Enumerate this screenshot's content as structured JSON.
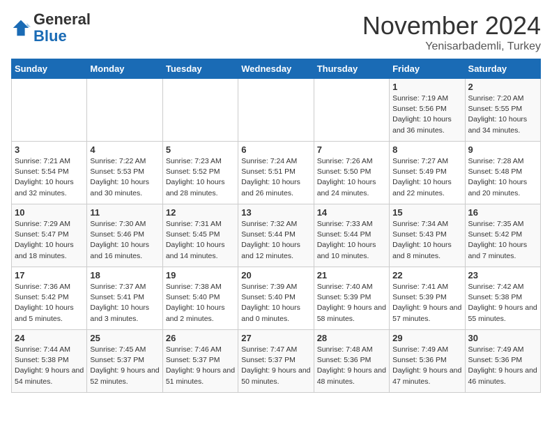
{
  "header": {
    "logo_general": "General",
    "logo_blue": "Blue",
    "month_title": "November 2024",
    "subtitle": "Yenisarbademli, Turkey"
  },
  "days_of_week": [
    "Sunday",
    "Monday",
    "Tuesday",
    "Wednesday",
    "Thursday",
    "Friday",
    "Saturday"
  ],
  "weeks": [
    [
      {
        "day": "",
        "info": ""
      },
      {
        "day": "",
        "info": ""
      },
      {
        "day": "",
        "info": ""
      },
      {
        "day": "",
        "info": ""
      },
      {
        "day": "",
        "info": ""
      },
      {
        "day": "1",
        "info": "Sunrise: 7:19 AM\nSunset: 5:56 PM\nDaylight: 10 hours and 36 minutes."
      },
      {
        "day": "2",
        "info": "Sunrise: 7:20 AM\nSunset: 5:55 PM\nDaylight: 10 hours and 34 minutes."
      }
    ],
    [
      {
        "day": "3",
        "info": "Sunrise: 7:21 AM\nSunset: 5:54 PM\nDaylight: 10 hours and 32 minutes."
      },
      {
        "day": "4",
        "info": "Sunrise: 7:22 AM\nSunset: 5:53 PM\nDaylight: 10 hours and 30 minutes."
      },
      {
        "day": "5",
        "info": "Sunrise: 7:23 AM\nSunset: 5:52 PM\nDaylight: 10 hours and 28 minutes."
      },
      {
        "day": "6",
        "info": "Sunrise: 7:24 AM\nSunset: 5:51 PM\nDaylight: 10 hours and 26 minutes."
      },
      {
        "day": "7",
        "info": "Sunrise: 7:26 AM\nSunset: 5:50 PM\nDaylight: 10 hours and 24 minutes."
      },
      {
        "day": "8",
        "info": "Sunrise: 7:27 AM\nSunset: 5:49 PM\nDaylight: 10 hours and 22 minutes."
      },
      {
        "day": "9",
        "info": "Sunrise: 7:28 AM\nSunset: 5:48 PM\nDaylight: 10 hours and 20 minutes."
      }
    ],
    [
      {
        "day": "10",
        "info": "Sunrise: 7:29 AM\nSunset: 5:47 PM\nDaylight: 10 hours and 18 minutes."
      },
      {
        "day": "11",
        "info": "Sunrise: 7:30 AM\nSunset: 5:46 PM\nDaylight: 10 hours and 16 minutes."
      },
      {
        "day": "12",
        "info": "Sunrise: 7:31 AM\nSunset: 5:45 PM\nDaylight: 10 hours and 14 minutes."
      },
      {
        "day": "13",
        "info": "Sunrise: 7:32 AM\nSunset: 5:44 PM\nDaylight: 10 hours and 12 minutes."
      },
      {
        "day": "14",
        "info": "Sunrise: 7:33 AM\nSunset: 5:44 PM\nDaylight: 10 hours and 10 minutes."
      },
      {
        "day": "15",
        "info": "Sunrise: 7:34 AM\nSunset: 5:43 PM\nDaylight: 10 hours and 8 minutes."
      },
      {
        "day": "16",
        "info": "Sunrise: 7:35 AM\nSunset: 5:42 PM\nDaylight: 10 hours and 7 minutes."
      }
    ],
    [
      {
        "day": "17",
        "info": "Sunrise: 7:36 AM\nSunset: 5:42 PM\nDaylight: 10 hours and 5 minutes."
      },
      {
        "day": "18",
        "info": "Sunrise: 7:37 AM\nSunset: 5:41 PM\nDaylight: 10 hours and 3 minutes."
      },
      {
        "day": "19",
        "info": "Sunrise: 7:38 AM\nSunset: 5:40 PM\nDaylight: 10 hours and 2 minutes."
      },
      {
        "day": "20",
        "info": "Sunrise: 7:39 AM\nSunset: 5:40 PM\nDaylight: 10 hours and 0 minutes."
      },
      {
        "day": "21",
        "info": "Sunrise: 7:40 AM\nSunset: 5:39 PM\nDaylight: 9 hours and 58 minutes."
      },
      {
        "day": "22",
        "info": "Sunrise: 7:41 AM\nSunset: 5:39 PM\nDaylight: 9 hours and 57 minutes."
      },
      {
        "day": "23",
        "info": "Sunrise: 7:42 AM\nSunset: 5:38 PM\nDaylight: 9 hours and 55 minutes."
      }
    ],
    [
      {
        "day": "24",
        "info": "Sunrise: 7:44 AM\nSunset: 5:38 PM\nDaylight: 9 hours and 54 minutes."
      },
      {
        "day": "25",
        "info": "Sunrise: 7:45 AM\nSunset: 5:37 PM\nDaylight: 9 hours and 52 minutes."
      },
      {
        "day": "26",
        "info": "Sunrise: 7:46 AM\nSunset: 5:37 PM\nDaylight: 9 hours and 51 minutes."
      },
      {
        "day": "27",
        "info": "Sunrise: 7:47 AM\nSunset: 5:37 PM\nDaylight: 9 hours and 50 minutes."
      },
      {
        "day": "28",
        "info": "Sunrise: 7:48 AM\nSunset: 5:36 PM\nDaylight: 9 hours and 48 minutes."
      },
      {
        "day": "29",
        "info": "Sunrise: 7:49 AM\nSunset: 5:36 PM\nDaylight: 9 hours and 47 minutes."
      },
      {
        "day": "30",
        "info": "Sunrise: 7:49 AM\nSunset: 5:36 PM\nDaylight: 9 hours and 46 minutes."
      }
    ]
  ]
}
